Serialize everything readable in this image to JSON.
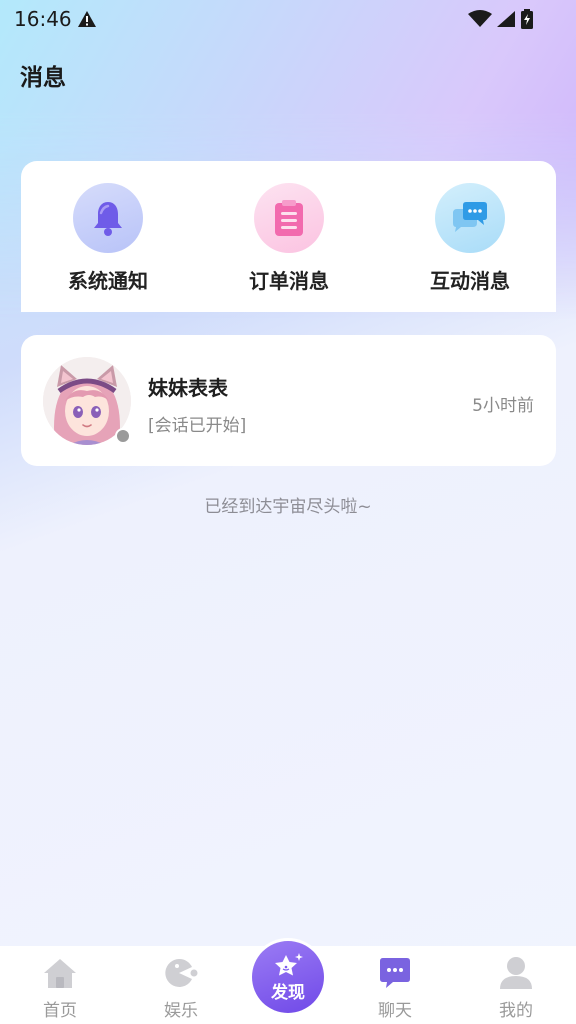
{
  "status_bar": {
    "time": "16:46"
  },
  "header": {
    "title": "消息"
  },
  "categories": [
    {
      "label": "系统通知",
      "icon": "bell-icon"
    },
    {
      "label": "订单消息",
      "icon": "clipboard-icon"
    },
    {
      "label": "互动消息",
      "icon": "chat-bubbles-icon"
    }
  ],
  "conversations": [
    {
      "name": "妹妹表表",
      "last_message": "[会话已开始]",
      "time": "5小时前",
      "online": false
    }
  ],
  "end_text": "已经到达宇宙尽头啦~",
  "tabbar": {
    "items": [
      {
        "label": "首页",
        "icon": "home-icon",
        "active": false
      },
      {
        "label": "娱乐",
        "icon": "game-icon",
        "active": false
      },
      {
        "label": "发现",
        "icon": "star-icon",
        "active": false
      },
      {
        "label": "聊天",
        "icon": "chat-icon",
        "active": true
      },
      {
        "label": "我的",
        "icon": "user-icon",
        "active": false
      }
    ]
  },
  "colors": {
    "accent": "#7049e8",
    "active_tab": "#6b53d6"
  }
}
